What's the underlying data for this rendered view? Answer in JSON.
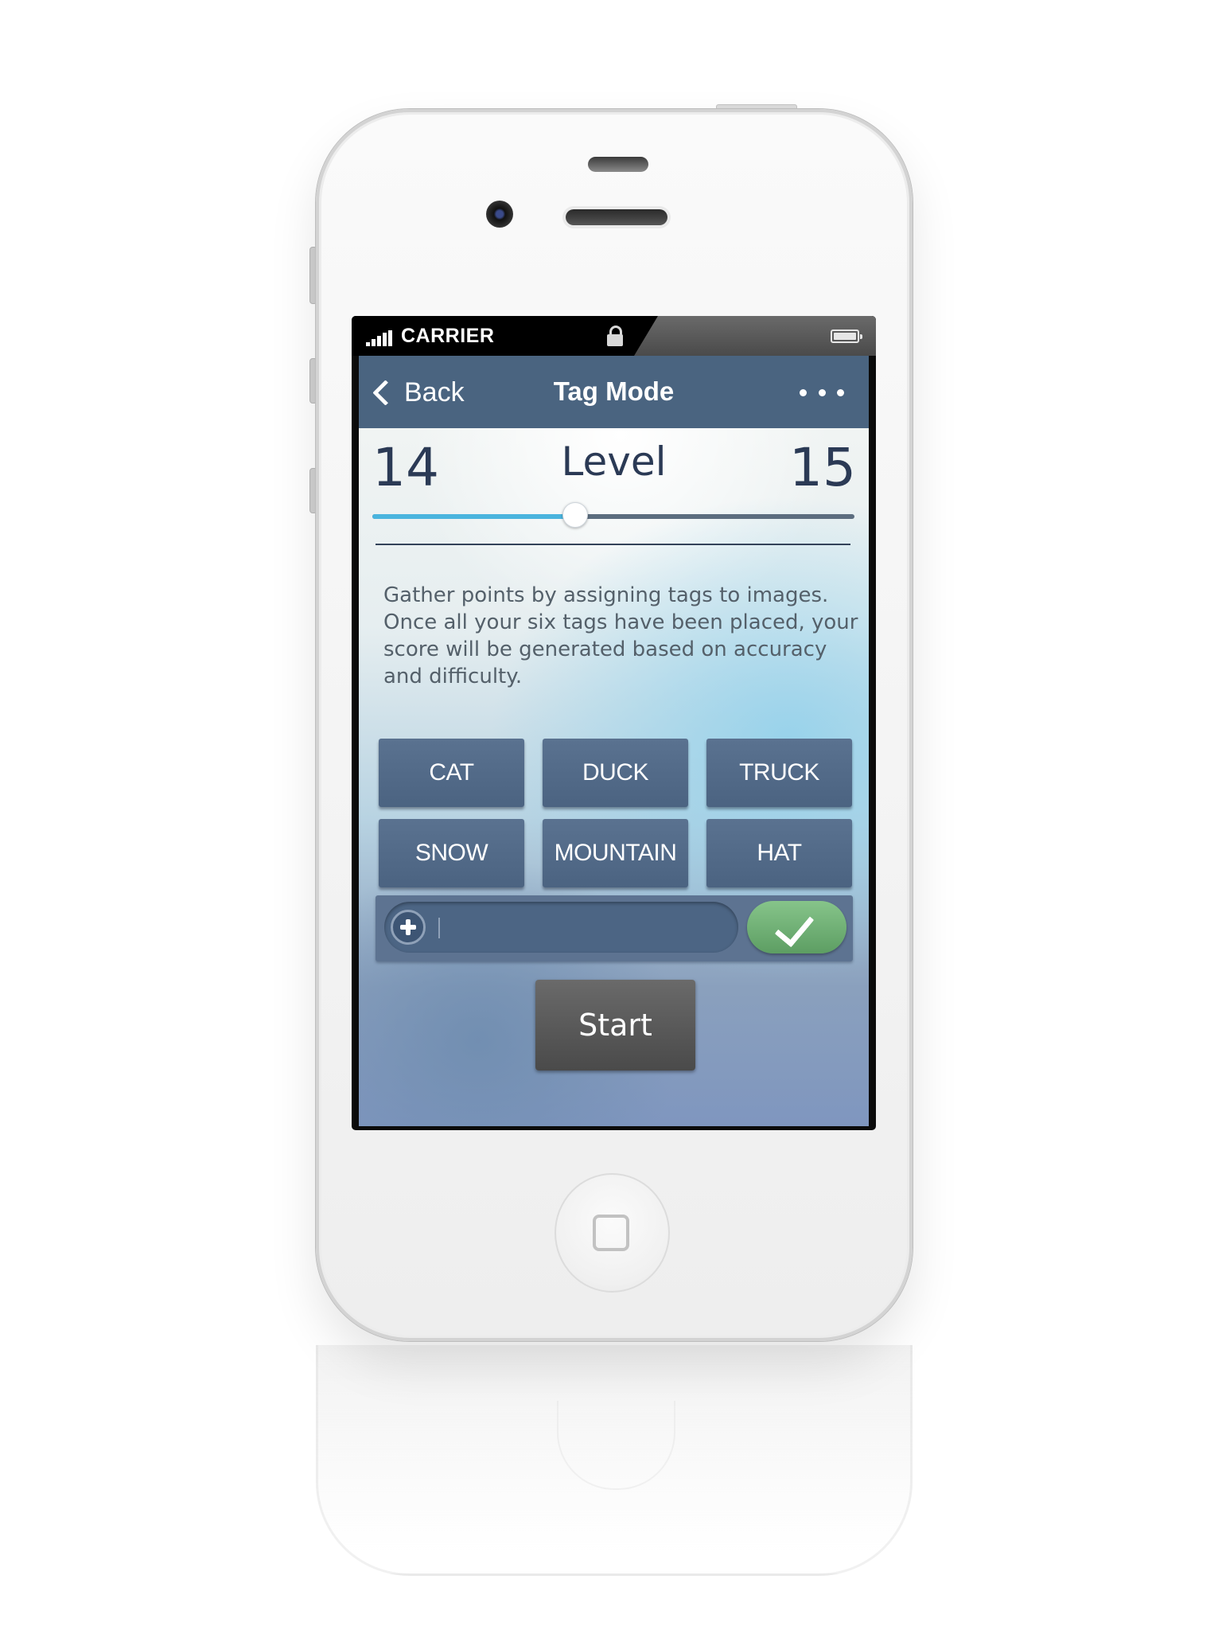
{
  "statusbar": {
    "carrier": "CARRIER",
    "lock_icon": "lock-icon",
    "battery_icon": "battery-icon",
    "signal_icon": "signal-bars-icon"
  },
  "navbar": {
    "back_label": "Back",
    "title": "Tag Mode",
    "more_icon": "more-dots-icon"
  },
  "level": {
    "current": "14",
    "next": "15",
    "label": "Level",
    "progress": 0.42
  },
  "description": "Gather points by assigning tags to images. Once all your six tags have been placed, your score will be generated based on accuracy and difficulty.",
  "tags": [
    "CAT",
    "DUCK",
    "TRUCK",
    "SNOW",
    "MOUNTAIN",
    "HAT"
  ],
  "tag_input": {
    "value": "",
    "placeholder": ""
  },
  "start_label": "Start",
  "colors": {
    "navbar": "#4a6480",
    "tag": "#4f6785",
    "slider_fill": "#4ab4de",
    "confirm": "#6fae74",
    "start": "#555555"
  }
}
